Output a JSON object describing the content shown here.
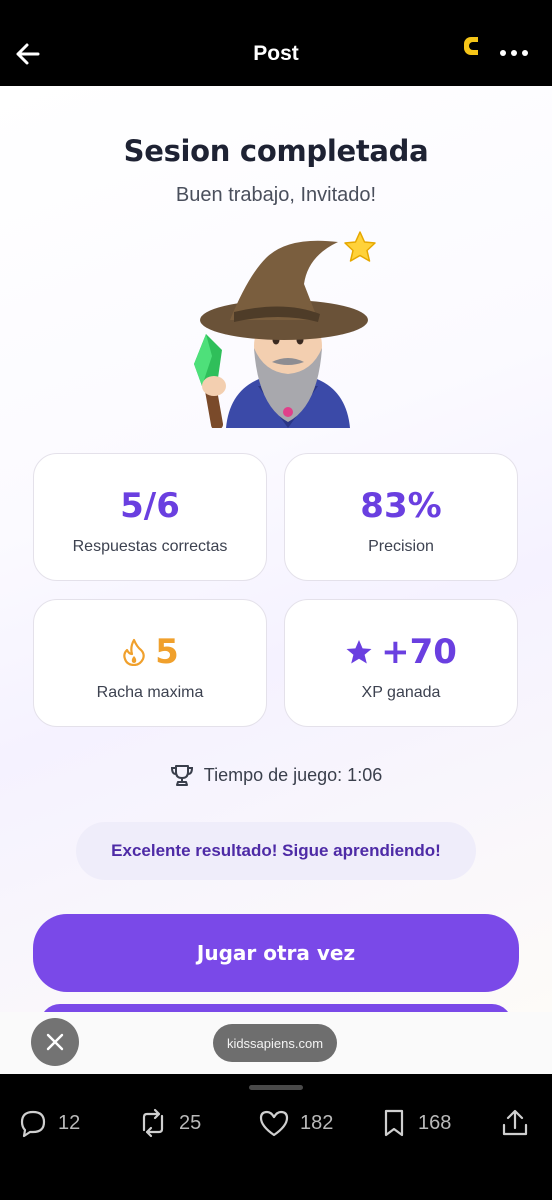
{
  "topbar": {
    "title": "Post"
  },
  "session": {
    "title": "Sesion completada",
    "subtitle": "Buen trabajo, Invitado!"
  },
  "stats": {
    "correct": {
      "value": "5/6",
      "label": "Respuestas correctas"
    },
    "precision": {
      "value": "83%",
      "label": "Precision"
    },
    "streak": {
      "value": "5",
      "label": "Racha maxima"
    },
    "xp": {
      "value": "+70",
      "label": "XP ganada"
    }
  },
  "play_time": "Tiempo de juego: 1:06",
  "message": "Excelente resultado! Sigue aprendiendo!",
  "buttons": {
    "play_again": "Jugar otra vez"
  },
  "overlay": {
    "domain": "kidssapiens.com"
  },
  "actions": {
    "replies": "12",
    "reposts": "25",
    "likes": "182",
    "bookmarks": "168"
  },
  "colors": {
    "accent": "#7a49e8",
    "stat_value": "#6a3fe0",
    "streak": "#f0a02c",
    "message_bg": "#efedfa",
    "message_text": "#4e2ba6"
  },
  "icons": {
    "back": "arrow-left-icon",
    "more": "more-dots-icon",
    "sparkle": "star-icon",
    "wizard": "wizard-emoji",
    "streak": "flame-icon",
    "xp": "star-icon",
    "time": "trophy-icon",
    "close": "close-icon",
    "reply": "reply-icon",
    "repost": "repost-icon",
    "like": "heart-icon",
    "bookmark": "bookmark-icon",
    "share": "share-icon"
  }
}
